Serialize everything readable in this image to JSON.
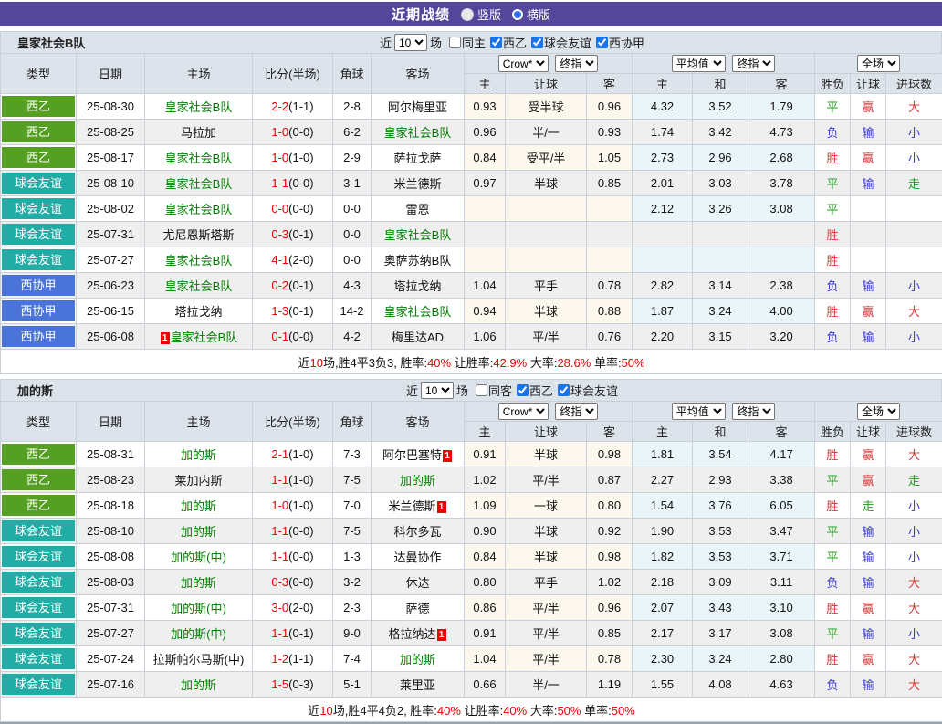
{
  "topbar": {
    "title": "近期战绩",
    "options": [
      {
        "label": "竖版",
        "selected": true
      },
      {
        "label": "横版",
        "selected": false
      }
    ]
  },
  "colors": {
    "header_purple": "#54469b",
    "league": {
      "西乙": "#55a022",
      "球会友谊": "#21ada6",
      "西协甲": "#4a74d8"
    },
    "team_highlight": "#008000",
    "score_red": "#e60000",
    "result_red": "#d83a3a",
    "result_green": "#1e9b1e",
    "result_blue": "#3b3bd6",
    "odds_bg": "#fdf8ee",
    "avg_bg": "#eaf5f9"
  },
  "misc": {
    "redcard_text": "1"
  },
  "sections": [
    {
      "team": "皇家社会B队",
      "filter": {
        "near_label": "近",
        "count": "10",
        "matches_label": "场",
        "checkboxes": [
          {
            "label": "同主",
            "checked": false
          },
          {
            "label": "西乙",
            "checked": true
          },
          {
            "label": "球会友谊",
            "checked": true
          },
          {
            "label": "西协甲",
            "checked": true
          }
        ]
      },
      "columns": [
        "类型",
        "日期",
        "主场",
        "比分(半场)",
        "角球",
        "客场"
      ],
      "dropdowns": {
        "odds_source": "Crow*",
        "odds_time": "终指",
        "avg_source": "平均值",
        "avg_time": "终指",
        "scope": "全场"
      },
      "sub_columns": [
        "主",
        "让球",
        "客",
        "主",
        "和",
        "客",
        "胜负",
        "让球",
        "进球数"
      ],
      "rows": [
        {
          "league": "西乙",
          "date": "25-08-30",
          "home": {
            "name": "皇家社会B队",
            "self": true
          },
          "score": "2-2",
          "half": "(1-1)",
          "corner": "2-8",
          "away": {
            "name": "阿尔梅里亚"
          },
          "crow": [
            "0.93",
            "受半球",
            "0.96"
          ],
          "avg": [
            "4.32",
            "3.52",
            "1.79"
          ],
          "results": [
            "平",
            "赢",
            "大"
          ]
        },
        {
          "league": "西乙",
          "date": "25-08-25",
          "home": {
            "name": "马拉加"
          },
          "score": "1-0",
          "half": "(0-0)",
          "corner": "6-2",
          "away": {
            "name": "皇家社会B队",
            "self": true
          },
          "crow": [
            "0.96",
            "半/一",
            "0.93"
          ],
          "avg": [
            "1.74",
            "3.42",
            "4.73"
          ],
          "results": [
            "负",
            "输",
            "小"
          ]
        },
        {
          "league": "西乙",
          "date": "25-08-17",
          "home": {
            "name": "皇家社会B队",
            "self": true
          },
          "score": "1-0",
          "half": "(1-0)",
          "corner": "2-9",
          "away": {
            "name": "萨拉戈萨"
          },
          "crow": [
            "0.84",
            "受平/半",
            "1.05"
          ],
          "avg": [
            "2.73",
            "2.96",
            "2.68"
          ],
          "results": [
            "胜",
            "赢",
            "小"
          ]
        },
        {
          "league": "球会友谊",
          "date": "25-08-10",
          "home": {
            "name": "皇家社会B队",
            "self": true
          },
          "score": "1-1",
          "half": "(0-0)",
          "corner": "3-1",
          "away": {
            "name": "米兰德斯"
          },
          "crow": [
            "0.97",
            "半球",
            "0.85"
          ],
          "avg": [
            "2.01",
            "3.03",
            "3.78"
          ],
          "results": [
            "平",
            "输",
            "走"
          ]
        },
        {
          "league": "球会友谊",
          "date": "25-08-02",
          "home": {
            "name": "皇家社会B队",
            "self": true
          },
          "score": "0-0",
          "half": "(0-0)",
          "corner": "0-0",
          "away": {
            "name": "雷恩"
          },
          "crow": [
            "",
            "",
            ""
          ],
          "avg": [
            "2.12",
            "3.26",
            "3.08"
          ],
          "results": [
            "平",
            "",
            ""
          ]
        },
        {
          "league": "球会友谊",
          "date": "25-07-31",
          "home": {
            "name": "尤尼恩斯塔斯"
          },
          "score": "0-3",
          "half": "(0-1)",
          "corner": "0-0",
          "away": {
            "name": "皇家社会B队",
            "self": true
          },
          "crow": [
            "",
            "",
            ""
          ],
          "avg": [
            "",
            "",
            ""
          ],
          "results": [
            "胜",
            "",
            ""
          ]
        },
        {
          "league": "球会友谊",
          "date": "25-07-27",
          "home": {
            "name": "皇家社会B队",
            "self": true
          },
          "score": "4-1",
          "half": "(2-0)",
          "corner": "0-0",
          "away": {
            "name": "奥萨苏纳B队"
          },
          "crow": [
            "",
            "",
            ""
          ],
          "avg": [
            "",
            "",
            ""
          ],
          "results": [
            "胜",
            "",
            ""
          ]
        },
        {
          "league": "西协甲",
          "date": "25-06-23",
          "home": {
            "name": "皇家社会B队",
            "self": true
          },
          "score": "0-2",
          "half": "(0-1)",
          "corner": "4-3",
          "away": {
            "name": "塔拉戈纳"
          },
          "crow": [
            "1.04",
            "平手",
            "0.78"
          ],
          "avg": [
            "2.82",
            "3.14",
            "2.38"
          ],
          "results": [
            "负",
            "输",
            "小"
          ]
        },
        {
          "league": "西协甲",
          "date": "25-06-15",
          "home": {
            "name": "塔拉戈纳"
          },
          "score": "1-3",
          "half": "(0-1)",
          "corner": "14-2",
          "away": {
            "name": "皇家社会B队",
            "self": true
          },
          "crow": [
            "0.94",
            "半球",
            "0.88"
          ],
          "avg": [
            "1.87",
            "3.24",
            "4.00"
          ],
          "results": [
            "胜",
            "赢",
            "大"
          ]
        },
        {
          "league": "西协甲",
          "date": "25-06-08",
          "home": {
            "name": "皇家社会B队",
            "self": true,
            "redcard": "before"
          },
          "score": "0-1",
          "half": "(0-0)",
          "corner": "4-2",
          "away": {
            "name": "梅里达AD"
          },
          "crow": [
            "1.06",
            "平/半",
            "0.76"
          ],
          "avg": [
            "2.20",
            "3.15",
            "3.20"
          ],
          "results": [
            "负",
            "输",
            "小"
          ]
        }
      ],
      "summary": [
        {
          "text": "近"
        },
        {
          "text": "10",
          "red": true
        },
        {
          "text": "场,胜4平3负3, 胜率:"
        },
        {
          "text": "40%",
          "red": true
        },
        {
          "text": " 让胜率:"
        },
        {
          "text": "42.9%",
          "red": true
        },
        {
          "text": " 大率:"
        },
        {
          "text": "28.6%",
          "red": true
        },
        {
          "text": " 单率:"
        },
        {
          "text": "50%",
          "red": true
        }
      ]
    },
    {
      "team": "加的斯",
      "filter": {
        "near_label": "近",
        "count": "10",
        "matches_label": "场",
        "checkboxes": [
          {
            "label": "同客",
            "checked": false
          },
          {
            "label": "西乙",
            "checked": true
          },
          {
            "label": "球会友谊",
            "checked": true
          }
        ]
      },
      "columns": [
        "类型",
        "日期",
        "主场",
        "比分(半场)",
        "角球",
        "客场"
      ],
      "dropdowns": {
        "odds_source": "Crow*",
        "odds_time": "终指",
        "avg_source": "平均值",
        "avg_time": "终指",
        "scope": "全场"
      },
      "sub_columns": [
        "主",
        "让球",
        "客",
        "主",
        "和",
        "客",
        "胜负",
        "让球",
        "进球数"
      ],
      "rows": [
        {
          "league": "西乙",
          "date": "25-08-31",
          "home": {
            "name": "加的斯",
            "self": true
          },
          "score": "2-1",
          "half": "(1-0)",
          "corner": "7-3",
          "away": {
            "name": "阿尔巴塞特",
            "redcard": "after"
          },
          "crow": [
            "0.91",
            "半球",
            "0.98"
          ],
          "avg": [
            "1.81",
            "3.54",
            "4.17"
          ],
          "results": [
            "胜",
            "赢",
            "大"
          ]
        },
        {
          "league": "西乙",
          "date": "25-08-23",
          "home": {
            "name": "莱加内斯"
          },
          "score": "1-1",
          "half": "(1-0)",
          "corner": "7-5",
          "away": {
            "name": "加的斯",
            "self": true
          },
          "crow": [
            "1.02",
            "平/半",
            "0.87"
          ],
          "avg": [
            "2.27",
            "2.93",
            "3.38"
          ],
          "results": [
            "平",
            "赢",
            "走"
          ]
        },
        {
          "league": "西乙",
          "date": "25-08-18",
          "home": {
            "name": "加的斯",
            "self": true
          },
          "score": "1-0",
          "half": "(1-0)",
          "corner": "7-0",
          "away": {
            "name": "米兰德斯",
            "redcard": "after"
          },
          "crow": [
            "1.09",
            "一球",
            "0.80"
          ],
          "avg": [
            "1.54",
            "3.76",
            "6.05"
          ],
          "results": [
            "胜",
            "走",
            "小"
          ]
        },
        {
          "league": "球会友谊",
          "date": "25-08-10",
          "home": {
            "name": "加的斯",
            "self": true
          },
          "score": "1-1",
          "half": "(0-0)",
          "corner": "7-5",
          "away": {
            "name": "科尔多瓦"
          },
          "crow": [
            "0.90",
            "半球",
            "0.92"
          ],
          "avg": [
            "1.90",
            "3.53",
            "3.47"
          ],
          "results": [
            "平",
            "输",
            "小"
          ]
        },
        {
          "league": "球会友谊",
          "date": "25-08-08",
          "home": {
            "name": "加的斯(中)",
            "self": true
          },
          "score": "1-1",
          "half": "(0-0)",
          "corner": "1-3",
          "away": {
            "name": "达曼协作"
          },
          "crow": [
            "0.84",
            "半球",
            "0.98"
          ],
          "avg": [
            "1.82",
            "3.53",
            "3.71"
          ],
          "results": [
            "平",
            "输",
            "小"
          ]
        },
        {
          "league": "球会友谊",
          "date": "25-08-03",
          "home": {
            "name": "加的斯",
            "self": true
          },
          "score": "0-3",
          "half": "(0-0)",
          "corner": "3-2",
          "away": {
            "name": "休达"
          },
          "crow": [
            "0.80",
            "平手",
            "1.02"
          ],
          "avg": [
            "2.18",
            "3.09",
            "3.11"
          ],
          "results": [
            "负",
            "输",
            "大"
          ]
        },
        {
          "league": "球会友谊",
          "date": "25-07-31",
          "home": {
            "name": "加的斯(中)",
            "self": true
          },
          "score": "3-0",
          "half": "(2-0)",
          "corner": "2-3",
          "away": {
            "name": "萨德"
          },
          "crow": [
            "0.86",
            "平/半",
            "0.96"
          ],
          "avg": [
            "2.07",
            "3.43",
            "3.10"
          ],
          "results": [
            "胜",
            "赢",
            "大"
          ]
        },
        {
          "league": "球会友谊",
          "date": "25-07-27",
          "home": {
            "name": "加的斯(中)",
            "self": true
          },
          "score": "1-1",
          "half": "(0-1)",
          "corner": "9-0",
          "away": {
            "name": "格拉纳达",
            "redcard": "after"
          },
          "crow": [
            "0.91",
            "平/半",
            "0.85"
          ],
          "avg": [
            "2.17",
            "3.17",
            "3.08"
          ],
          "results": [
            "平",
            "输",
            "小"
          ]
        },
        {
          "league": "球会友谊",
          "date": "25-07-24",
          "home": {
            "name": "拉斯帕尔马斯(中)"
          },
          "score": "1-2",
          "half": "(1-1)",
          "corner": "7-4",
          "away": {
            "name": "加的斯",
            "self": true
          },
          "crow": [
            "1.04",
            "平/半",
            "0.78"
          ],
          "avg": [
            "2.30",
            "3.24",
            "2.80"
          ],
          "results": [
            "胜",
            "赢",
            "大"
          ]
        },
        {
          "league": "球会友谊",
          "date": "25-07-16",
          "home": {
            "name": "加的斯",
            "self": true
          },
          "score": "1-5",
          "half": "(0-3)",
          "corner": "5-1",
          "away": {
            "name": "莱里亚"
          },
          "crow": [
            "0.66",
            "半/一",
            "1.19"
          ],
          "avg": [
            "1.55",
            "4.08",
            "4.63"
          ],
          "results": [
            "负",
            "输",
            "大"
          ]
        }
      ],
      "summary": [
        {
          "text": "近"
        },
        {
          "text": "10",
          "red": true
        },
        {
          "text": "场,胜4平4负2, 胜率:"
        },
        {
          "text": "40%",
          "red": true
        },
        {
          "text": " 让胜率:"
        },
        {
          "text": "40%",
          "red": true
        },
        {
          "text": " 大率:"
        },
        {
          "text": "50%",
          "red": true
        },
        {
          "text": " 单率:"
        },
        {
          "text": "50%",
          "red": true
        }
      ]
    }
  ]
}
